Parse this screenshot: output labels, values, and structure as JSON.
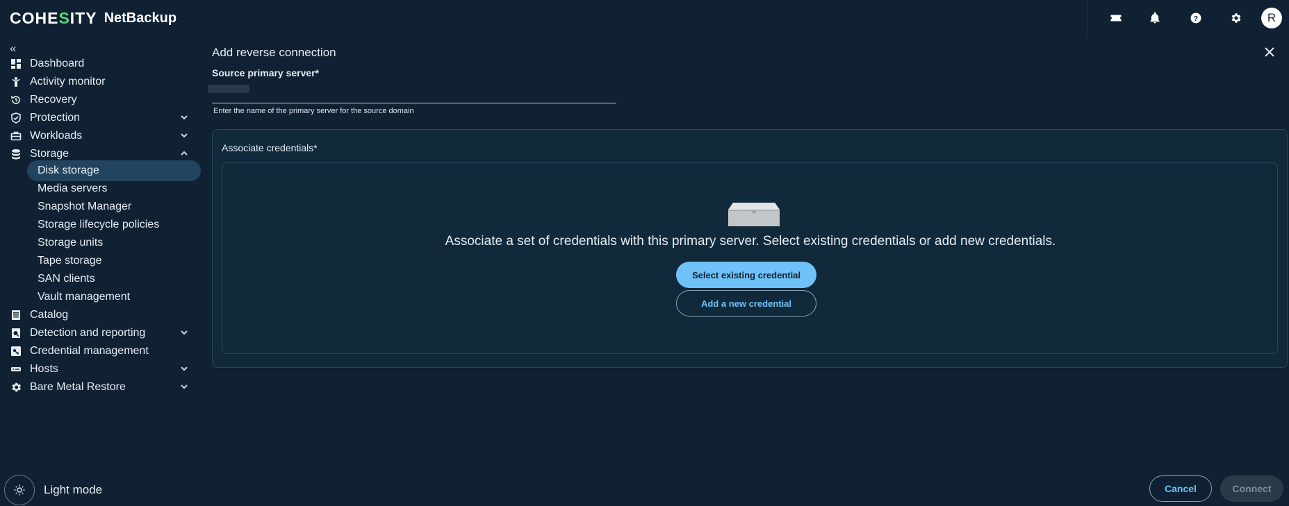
{
  "brand": {
    "logo_prefix": "COHE",
    "logo_accent": "S",
    "logo_suffix": "ITY",
    "product": "NetBackup"
  },
  "topbar": {
    "icons": [
      "ticket-icon",
      "bell-icon",
      "help-icon",
      "gear-icon"
    ],
    "avatar_initial": "R"
  },
  "sidebar": {
    "collapse": "«",
    "items": [
      {
        "label": "Dashboard",
        "icon": "dashboard-icon"
      },
      {
        "label": "Activity monitor",
        "icon": "activity-icon"
      },
      {
        "label": "Recovery",
        "icon": "recovery-icon"
      },
      {
        "label": "Protection",
        "icon": "shield-icon",
        "expandable": true
      },
      {
        "label": "Workloads",
        "icon": "briefcase-icon",
        "expandable": true
      },
      {
        "label": "Storage",
        "icon": "database-icon",
        "expanded": true
      },
      {
        "label": "Catalog",
        "icon": "catalog-icon"
      },
      {
        "label": "Detection and reporting",
        "icon": "report-icon",
        "expandable": true
      },
      {
        "label": "Credential management",
        "icon": "key-icon"
      },
      {
        "label": "Hosts",
        "icon": "server-icon",
        "expandable": true
      },
      {
        "label": "Bare Metal Restore",
        "icon": "cog-icon",
        "expandable": true
      }
    ],
    "storage_sub": [
      {
        "label": "Disk storage",
        "active": true
      },
      {
        "label": "Media servers"
      },
      {
        "label": "Snapshot Manager"
      },
      {
        "label": "Storage lifecycle policies"
      },
      {
        "label": "Storage units"
      },
      {
        "label": "Tape storage"
      },
      {
        "label": "SAN clients"
      },
      {
        "label": "Vault management"
      }
    ],
    "light_mode_label": "Light mode"
  },
  "main": {
    "title": "Add reverse connection",
    "source_label": "Source primary server*",
    "source_value": "",
    "source_hint": "Enter the name of the primary server for the source domain",
    "cred_title": "Associate credentials*",
    "empty_message": "Associate a set of credentials with this primary server. Select existing credentials or add new credentials.",
    "select_existing": "Select existing credential",
    "add_new": "Add a new credential",
    "cancel": "Cancel",
    "connect": "Connect"
  },
  "colors": {
    "background": "#0f2132",
    "accent": "#6fc2f7",
    "active_nav": "#22445e",
    "brand_accent": "#5bd67a"
  }
}
